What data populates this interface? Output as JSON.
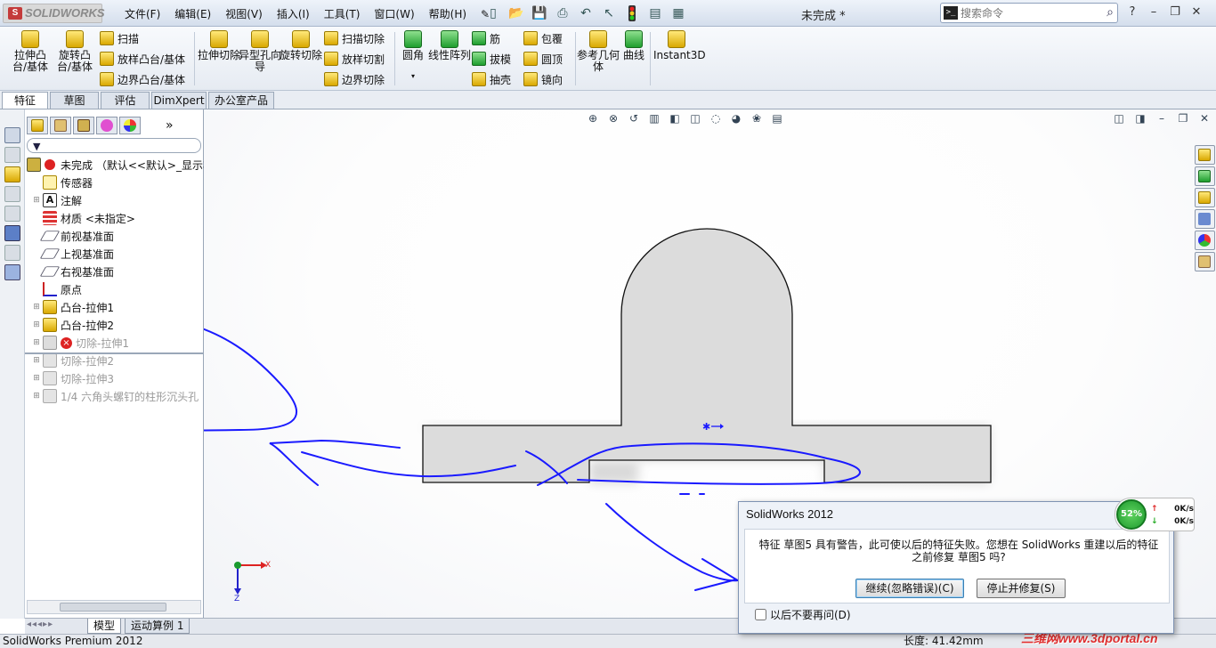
{
  "app": {
    "logo_text": "SOLIDWORKS",
    "document_title": "未完成 *"
  },
  "menu": [
    "文件(F)",
    "编辑(E)",
    "视图(V)",
    "插入(I)",
    "工具(T)",
    "窗口(W)",
    "帮助(H)"
  ],
  "search": {
    "placeholder": "搜索命令"
  },
  "commands": {
    "extrude_boss": "拉伸凸台/基体",
    "revolve_boss": "旋转凸台/基体",
    "sweep": "扫描",
    "loft_boss": "放样凸台/基体",
    "boundary_boss": "边界凸台/基体",
    "extrude_cut": "拉伸切除",
    "hole_wizard": "异型孔向导",
    "revolve_cut": "旋转切除",
    "sweep_cut": "扫描切除",
    "loft_cut": "放样切割",
    "boundary_cut": "边界切除",
    "fillet": "圆角",
    "linear_pattern": "线性阵列",
    "rib": "筋",
    "draft": "拔模",
    "shell": "抽壳",
    "wrap": "包覆",
    "dome": "圆顶",
    "mirror": "镜向",
    "ref_geometry": "参考几何体",
    "curves": "曲线",
    "instant3d": "Instant3D"
  },
  "tabs": [
    "特征",
    "草图",
    "评估",
    "DimXpert",
    "办公室产品"
  ],
  "tree": {
    "root": "未完成 （默认<<默认>_显示状",
    "items": [
      {
        "label": "传感器"
      },
      {
        "label": "注解"
      },
      {
        "label": "材质 <未指定>"
      },
      {
        "label": "前视基准面"
      },
      {
        "label": "上视基准面"
      },
      {
        "label": "右视基准面"
      },
      {
        "label": "原点"
      },
      {
        "label": "凸台-拉伸1"
      },
      {
        "label": "凸台-拉伸2"
      },
      {
        "label": "切除-拉伸1"
      },
      {
        "label": "切除-拉伸2"
      },
      {
        "label": "切除-拉伸3"
      },
      {
        "label": "1/4 六角头螺钉的柱形沉头孔"
      }
    ]
  },
  "bottom_tabs": [
    "模型",
    "运动算例 1"
  ],
  "triad": {
    "x": "X",
    "z": "Z"
  },
  "dialog": {
    "title": "SolidWorks 2012",
    "message": "特征 草图5 具有警告，此可使以后的特征失败。您想在 SolidWorks 重建以后的特征之前修复 草图5 吗?",
    "continue_button": "继续(忽略错误)(C)",
    "stop_button": "停止并修复(S)",
    "dont_ask": "以后不要再问(D)"
  },
  "net_monitor": {
    "percent": "52%",
    "up": "0K/s",
    "down": "0K/s"
  },
  "status": {
    "product": "SolidWorks Premium 2012",
    "length": "长度: 41.42mm",
    "watermark": "三维网www.3dportal.cn"
  },
  "colors": {
    "annotation_blue": "#1a1aff",
    "part_fill": "#dcdcdc",
    "error_red": "#d62020"
  }
}
